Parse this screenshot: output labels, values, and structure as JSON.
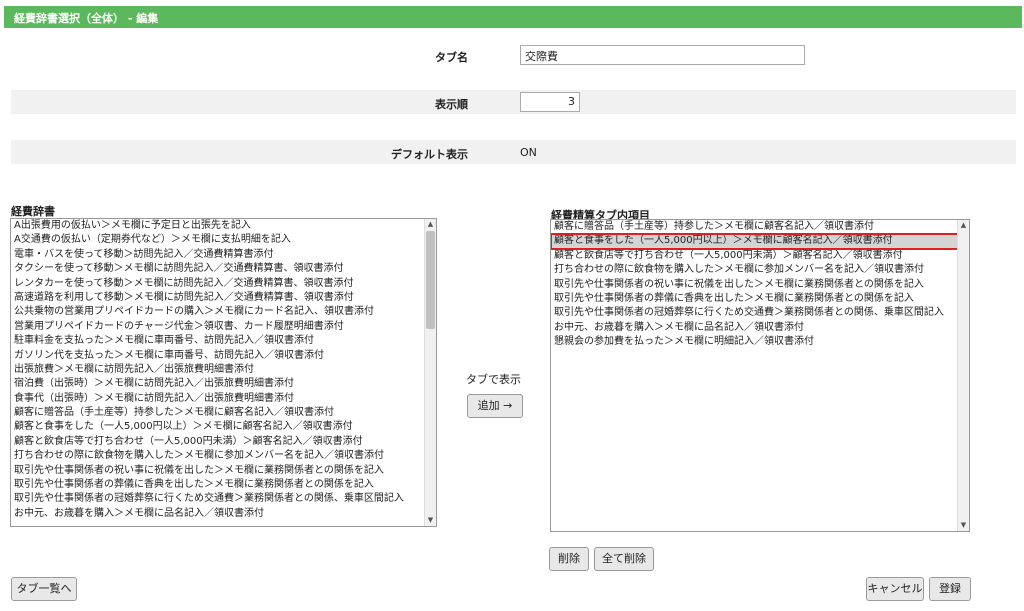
{
  "header": {
    "title": "経費辞書選択（全体） - 編集"
  },
  "form": {
    "tab_name_label": "タブ名",
    "tab_name_value": "交際費",
    "order_label": "表示順",
    "order_value": "3",
    "default_label": "デフォルト表示",
    "default_value": "ON"
  },
  "dictionary": {
    "label": "経費辞書",
    "items": [
      "A出張費用の仮払い＞メモ欄に予定日と出張先を記入",
      "A交通費の仮払い（定期券代など）＞メモ欄に支払明細を記入",
      "電車・バスを使って移動＞訪問先記入／交通費精算書添付",
      "タクシーを使って移動＞メモ欄に訪問先記入／交通費精算書、領収書添付",
      "レンタカーを使って移動＞メモ欄に訪問先記入／交通費精算書、領収書添付",
      "高速道路を利用して移動＞メモ欄に訪問先記入／交通費精算書、領収書添付",
      "公共乗物の営業用プリペイドカードの購入＞メモ欄にカード名記入、領収書添付",
      "営業用プリペイドカードのチャージ代金＞領収書、カード履歴明細書添付",
      "駐車料金を支払った＞メモ欄に車両番号、訪問先記入／領収書添付",
      "ガソリン代を支払った＞メモ欄に車両番号、訪問先記入／領収書添付",
      "出張旅費＞メモ欄に訪問先記入／出張旅費明細書添付",
      "宿泊費（出張時）＞メモ欄に訪問先記入／出張旅費明細書添付",
      "食事代（出張時）＞メモ欄に訪問先記入／出張旅費明細書添付",
      "顧客に贈答品（手土産等）持参した＞メモ欄に顧客名記入／領収書添付",
      "顧客と食事をした（一人5,000円以上）＞メモ欄に顧客名記入／領収書添付",
      "顧客と飲食店等で打ち合わせ（一人5,000円未満）＞顧客名記入／領収書添付",
      "打ち合わせの際に飲食物を購入した＞メモ欄に参加メンバー名を記入／領収書添付",
      "取引先や仕事関係者の祝い事に祝儀を出した＞メモ欄に業務関係者との関係を記入",
      "取引先や仕事関係者の葬儀に香典を出した＞メモ欄に業務関係者との関係を記入",
      "取引先や仕事関係者の冠婚葬祭に行くため交通費＞業務関係者との関係、乗車区間記入",
      "お中元、お歳暮を購入＞メモ欄に品名記入／領収書添付"
    ]
  },
  "middle": {
    "tab_display_label": "タブで表示",
    "add_button": "追加 →"
  },
  "tab_items": {
    "label": "経費精算タブ内項目",
    "items": [
      "顧客に贈答品（手土産等）持参した＞メモ欄に顧客名記入／領収書添付",
      "顧客と食事をした（一人5,000円以上）＞メモ欄に顧客名記入／領収書添付",
      "顧客と飲食店等で打ち合わせ（一人5,000円未満）＞顧客名記入／領収書添付",
      "打ち合わせの際に飲食物を購入した＞メモ欄に参加メンバー名を記入／領収書添付",
      "取引先や仕事関係者の祝い事に祝儀を出した＞メモ欄に業務関係者との関係を記入",
      "取引先や仕事関係者の葬儀に香典を出した＞メモ欄に業務関係者との関係を記入",
      "取引先や仕事関係者の冠婚葬祭に行くため交通費＞業務関係者との関係、乗車区間記入",
      "お中元、お歳暮を購入＞メモ欄に品名記入／領収書添付",
      "懇親会の参加費を払った＞メモ欄に明細記入／領収書添付"
    ],
    "delete_button": "削除",
    "delete_all_button": "全て削除"
  },
  "footer": {
    "back_button": "タブ一覧へ",
    "cancel_button": "キャンセル",
    "save_button": "登録"
  }
}
